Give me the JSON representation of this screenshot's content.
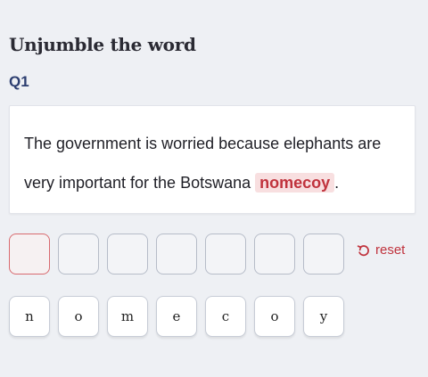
{
  "page": {
    "title": "Unjumble the word",
    "question_number": "Q1"
  },
  "question": {
    "before": "The government is worried because elephants are very important for the Botswana ",
    "scrambled": "nomecoy",
    "after": "."
  },
  "answer": {
    "slot_count": 7
  },
  "reset": {
    "label": "reset",
    "icon": "undo-icon"
  },
  "tiles": [
    "n",
    "o",
    "m",
    "e",
    "c",
    "o",
    "y"
  ],
  "colors": {
    "accent": "#c0333d",
    "highlight_bg": "#f8dfe0",
    "question_label": "#2c3e70",
    "background": "#eef0f4"
  }
}
